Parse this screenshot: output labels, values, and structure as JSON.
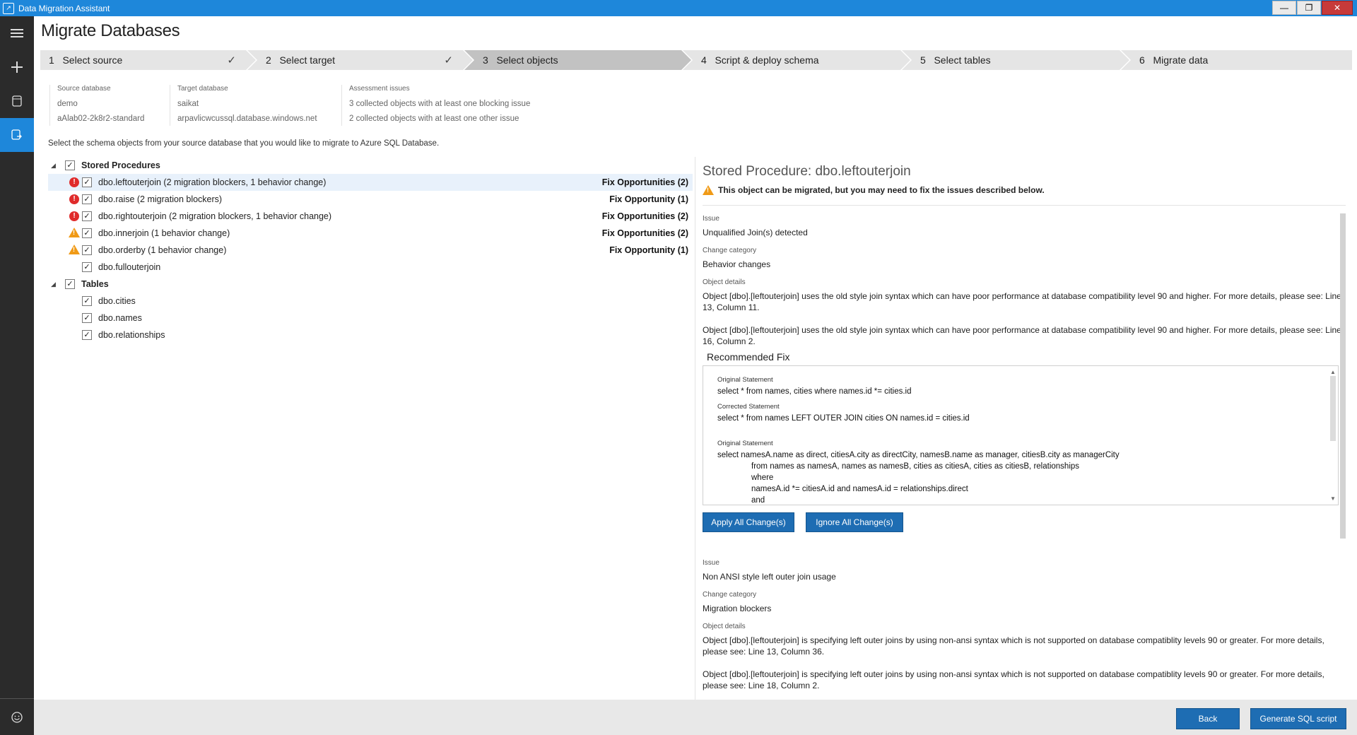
{
  "window": {
    "title": "Data Migration Assistant",
    "minimize": "—",
    "maximize": "❐",
    "close": "✕"
  },
  "rail": {
    "items": [
      {
        "name": "menu-icon",
        "glyph": "☰"
      },
      {
        "name": "new-project-icon",
        "glyph": "+"
      },
      {
        "name": "assessments-icon",
        "glyph": "⎕"
      },
      {
        "name": "migrations-icon",
        "glyph": "⎙"
      }
    ],
    "feedback_glyph": "☺"
  },
  "page_title": "Migrate Databases",
  "steps": [
    {
      "num": "1",
      "label": "Select source",
      "done": true
    },
    {
      "num": "2",
      "label": "Select target",
      "done": true
    },
    {
      "num": "3",
      "label": "Select objects",
      "active": true
    },
    {
      "num": "4",
      "label": "Script & deploy schema"
    },
    {
      "num": "5",
      "label": "Select tables"
    },
    {
      "num": "6",
      "label": "Migrate data"
    }
  ],
  "info": {
    "source": {
      "label": "Source database",
      "name": "demo",
      "server": "aAlab02-2k8r2-standard"
    },
    "target": {
      "label": "Target database",
      "name": "saikat",
      "server": "arpavlicwcussql.database.windows.net"
    },
    "assessment": {
      "label": "Assessment issues",
      "line1": "3 collected objects with at least one blocking issue",
      "line2": "2 collected objects with at least one other issue"
    }
  },
  "instruction": "Select the schema objects from your source database that you would like to migrate to Azure SQL Database.",
  "tree": {
    "stored_procedures": {
      "label": "Stored Procedures",
      "items": [
        {
          "label": "dbo.leftouterjoin (2 migration blockers, 1 behavior change)",
          "status": "error",
          "fix": "Fix Opportunities (2)",
          "selected": true
        },
        {
          "label": "dbo.raise (2 migration blockers)",
          "status": "error",
          "fix": "Fix Opportunity (1)"
        },
        {
          "label": "dbo.rightouterjoin (2 migration blockers, 1 behavior change)",
          "status": "error",
          "fix": "Fix Opportunities (2)"
        },
        {
          "label": "dbo.innerjoin (1 behavior change)",
          "status": "warning",
          "fix": "Fix Opportunities (2)"
        },
        {
          "label": "dbo.orderby (1 behavior change)",
          "status": "warning",
          "fix": "Fix Opportunity (1)"
        },
        {
          "label": "dbo.fullouterjoin",
          "status": "none",
          "fix": ""
        }
      ]
    },
    "tables": {
      "label": "Tables",
      "items": [
        {
          "label": "dbo.cities"
        },
        {
          "label": "dbo.names"
        },
        {
          "label": "dbo.relationships"
        }
      ]
    }
  },
  "details": {
    "title": "Stored Procedure: dbo.leftouterjoin",
    "warning": "This object can be migrated, but you may need to fix the issues described below.",
    "issue_label": "Issue",
    "change_label": "Change category",
    "object_label": "Object details",
    "issues": [
      {
        "issue": "Unqualified Join(s) detected",
        "category": "Behavior changes",
        "details": [
          "Object [dbo].[leftouterjoin] uses the old style join syntax which can have poor performance at database compatibility level 90 and higher. For more details, please see: Line 13, Column 11.",
          "Object [dbo].[leftouterjoin] uses the old style join syntax which can have poor performance at database compatibility level 90 and higher. For more details, please see: Line 16, Column 2."
        ]
      },
      {
        "issue": "Non ANSI style left outer join usage",
        "category": "Migration blockers",
        "details": [
          "Object [dbo].[leftouterjoin] is specifying left outer joins by using non-ansi syntax which is not supported on database compatiblity levels 90 or greater. For more details, please see: Line 13, Column 36.",
          "Object [dbo].[leftouterjoin] is specifying left outer joins by using non-ansi syntax which is not supported on database compatiblity levels 90 or greater. For more details, please see: Line 18, Column 2."
        ]
      }
    ],
    "recommended_fix": {
      "title": "Recommended Fix",
      "original_label": "Original Statement",
      "corrected_label": "Corrected Statement",
      "original_1": "select * from names, cities where names.id *= cities.id",
      "corrected_1": "select * from names LEFT OUTER JOIN cities ON names.id = cities.id",
      "original_2_line1": "select namesA.name as direct, citiesA.city as directCity, namesB.name as manager, citiesB.city as managerCity",
      "original_2_line2": "from names as namesA, names as namesB, cities as citiesA, cities as citiesB, relationships",
      "original_2_line3": "where",
      "original_2_line4": "namesA.id *= citiesA.id and namesA.id = relationships.direct",
      "original_2_line5": "and"
    },
    "apply_btn": "Apply All Change(s)",
    "ignore_btn": "Ignore All Change(s)"
  },
  "footer": {
    "back": "Back",
    "generate": "Generate SQL script"
  },
  "colors": {
    "accent": "#1e87da",
    "button": "#1e6db3",
    "error": "#e02b2b",
    "warning": "#f09a16"
  }
}
